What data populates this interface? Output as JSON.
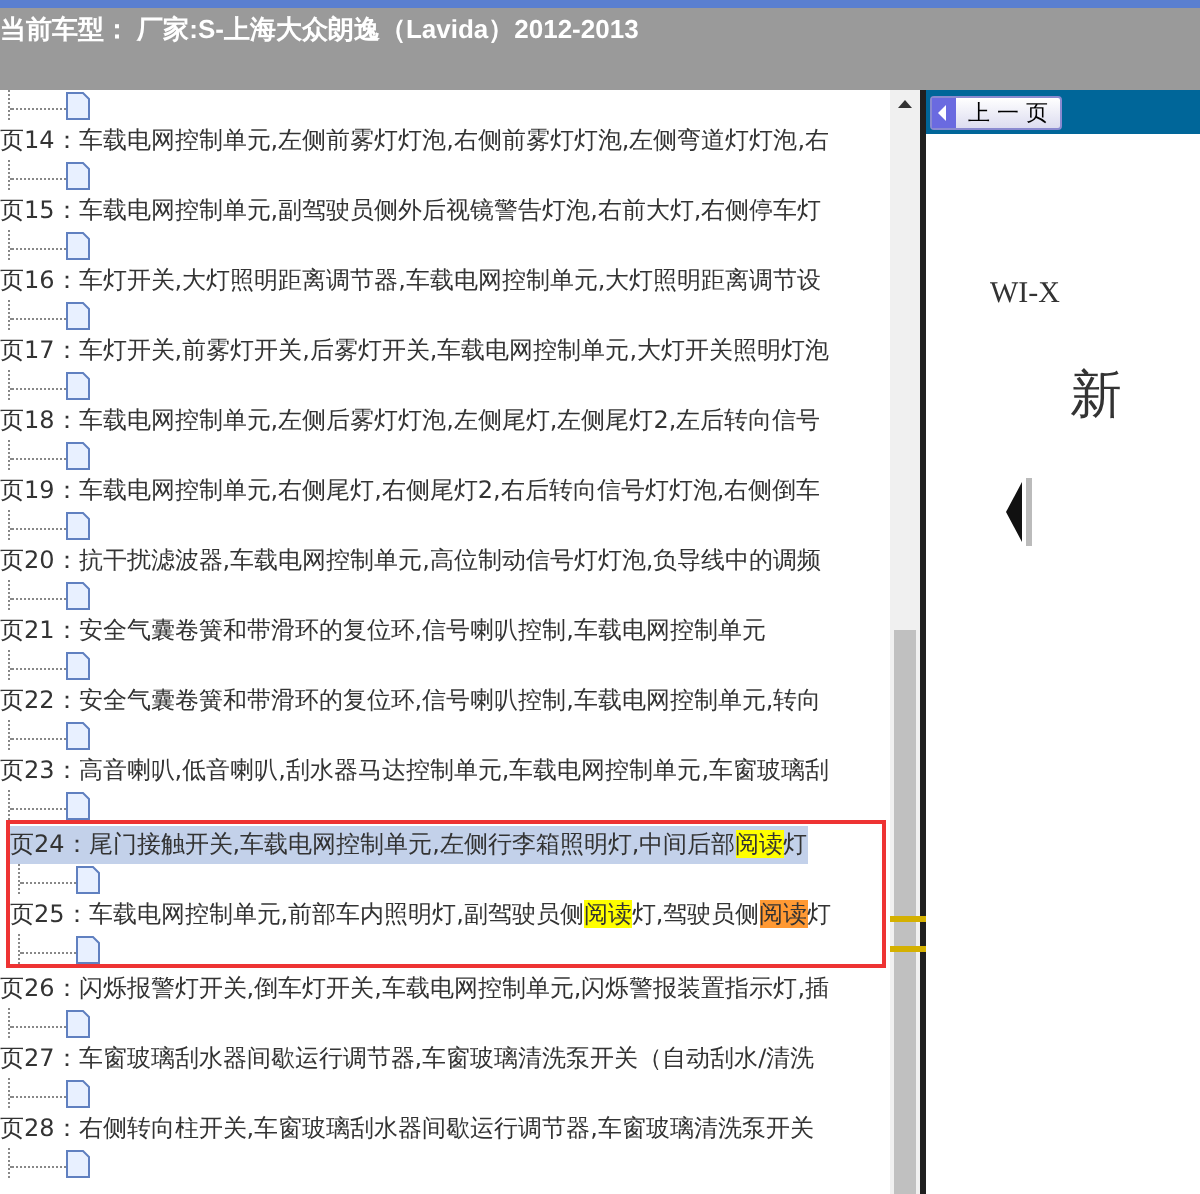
{
  "header": {
    "title": "当前车型： 厂家:S-上海大众朗逸（Lavida）2012-2013"
  },
  "tree": {
    "items": [
      {
        "selected": false,
        "boxed": false,
        "segments": [
          {
            "text": "页14：车载电网控制单元,左侧前雾灯灯泡,右侧前雾灯灯泡,左侧弯道灯灯泡,右"
          }
        ]
      },
      {
        "selected": false,
        "boxed": false,
        "segments": [
          {
            "text": "页15：车载电网控制单元,副驾驶员侧外后视镜警告灯泡,右前大灯,右侧停车灯"
          }
        ]
      },
      {
        "selected": false,
        "boxed": false,
        "segments": [
          {
            "text": "页16：车灯开关,大灯照明距离调节器,车载电网控制单元,大灯照明距离调节设"
          }
        ]
      },
      {
        "selected": false,
        "boxed": false,
        "segments": [
          {
            "text": "页17：车灯开关,前雾灯开关,后雾灯开关,车载电网控制单元,大灯开关照明灯泡"
          }
        ]
      },
      {
        "selected": false,
        "boxed": false,
        "segments": [
          {
            "text": "页18：车载电网控制单元,左侧后雾灯灯泡,左侧尾灯,左侧尾灯2,左后转向信号"
          }
        ]
      },
      {
        "selected": false,
        "boxed": false,
        "segments": [
          {
            "text": "页19：车载电网控制单元,右侧尾灯,右侧尾灯2,右后转向信号灯灯泡,右侧倒车"
          }
        ]
      },
      {
        "selected": false,
        "boxed": false,
        "segments": [
          {
            "text": "页20：抗干扰滤波器,车载电网控制单元,高位制动信号灯灯泡,负导线中的调频"
          }
        ]
      },
      {
        "selected": false,
        "boxed": false,
        "segments": [
          {
            "text": "页21：安全气囊卷簧和带滑环的复位环,信号喇叭控制,车载电网控制单元"
          }
        ]
      },
      {
        "selected": false,
        "boxed": false,
        "segments": [
          {
            "text": "页22：安全气囊卷簧和带滑环的复位环,信号喇叭控制,车载电网控制单元,转向"
          }
        ]
      },
      {
        "selected": false,
        "boxed": false,
        "segments": [
          {
            "text": "页23：高音喇叭,低音喇叭,刮水器马达控制单元,车载电网控制单元,车窗玻璃刮"
          }
        ]
      },
      {
        "selected": true,
        "boxed": true,
        "segments": [
          {
            "text": "页24：尾门接触开关,车载电网控制单元,左侧行李箱照明灯,中间后部"
          },
          {
            "text": "阅读",
            "color": "#ffff00"
          },
          {
            "text": "灯"
          }
        ]
      },
      {
        "selected": false,
        "boxed": true,
        "segments": [
          {
            "text": "页25：车载电网控制单元,前部车内照明灯,副驾驶员侧"
          },
          {
            "text": "阅读",
            "color": "#ffff00"
          },
          {
            "text": "灯,驾驶员侧"
          },
          {
            "text": "阅读",
            "color": "#ff9933"
          },
          {
            "text": "灯"
          }
        ]
      },
      {
        "selected": false,
        "boxed": false,
        "segments": [
          {
            "text": "页26：闪烁报警灯开关,倒车灯开关,车载电网控制单元,闪烁警报装置指示灯,插"
          }
        ]
      },
      {
        "selected": false,
        "boxed": false,
        "segments": [
          {
            "text": "页27：车窗玻璃刮水器间歇运行调节器,车窗玻璃清洗泵开关（自动刮水/清洗"
          }
        ]
      },
      {
        "selected": false,
        "boxed": false,
        "segments": [
          {
            "text": "页28：右侧转向柱开关,车窗玻璃刮水器间歇运行调节器,车窗玻璃清洗泵开关"
          }
        ]
      }
    ]
  },
  "viewer": {
    "prev_button": "上 一 页",
    "doc_code": "WI-X",
    "doc_title": "新"
  }
}
